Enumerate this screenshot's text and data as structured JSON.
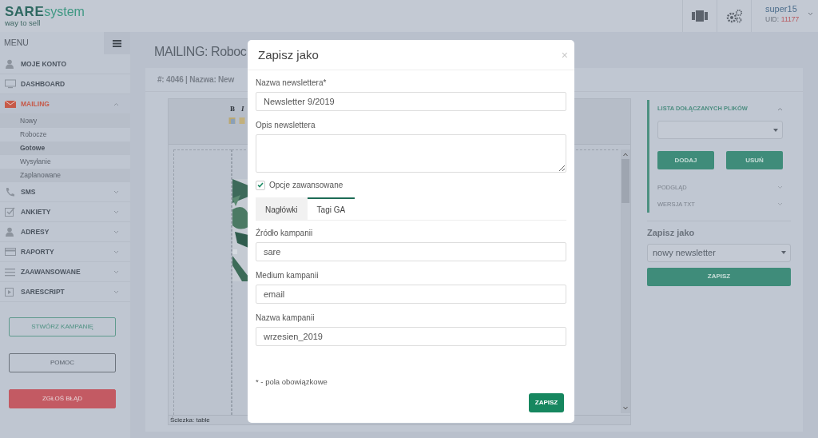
{
  "logo": {
    "brand": "SARE",
    "product": "system",
    "tagline": "way to sell"
  },
  "header": {
    "user": "super15",
    "uid_label": "UID:",
    "uid": "11177"
  },
  "sidebar": {
    "title": "MENU",
    "items": [
      {
        "label": "MOJE KONTO",
        "kind": "link",
        "selected": false
      },
      {
        "label": "DASHBOARD",
        "kind": "link",
        "selected": false
      },
      {
        "label": "MAILING",
        "kind": "group",
        "selected": true,
        "expanded": true,
        "children": [
          {
            "label": "Nowy",
            "selected": false
          },
          {
            "label": "Robocze",
            "selected": false
          },
          {
            "label": "Gotowe",
            "selected": true
          },
          {
            "label": "Wysyłanie",
            "selected": false
          },
          {
            "label": "Zaplanowane",
            "selected": false
          }
        ]
      },
      {
        "label": "SMS",
        "kind": "group",
        "selected": false,
        "expanded": false
      },
      {
        "label": "ANKIETY",
        "kind": "group",
        "selected": false,
        "expanded": false
      },
      {
        "label": "ADRESY",
        "kind": "group",
        "selected": false,
        "expanded": false
      },
      {
        "label": "RAPORTY",
        "kind": "group",
        "selected": false,
        "expanded": false
      },
      {
        "label": "ZAAWANSOWANE",
        "kind": "group",
        "selected": false,
        "expanded": false
      },
      {
        "label": "SARESCRIPT",
        "kind": "group",
        "selected": false,
        "expanded": false
      }
    ],
    "buttons": [
      {
        "label": "STWÓRZ KAMPANIĘ",
        "kind": "outline-primary"
      },
      {
        "label": "POMOC",
        "kind": "outline-dark"
      },
      {
        "label": "ZGŁOŚ BŁĄD",
        "kind": "danger"
      }
    ]
  },
  "main": {
    "title": "MAILING: Roboc",
    "panel_heading": "#: 4046 | Nazwa: New",
    "editor": {
      "toolbar": [
        "B",
        "I"
      ],
      "path": "Ściezka: table"
    },
    "attachments": {
      "title": "LISTA DOŁĄCZANYCH PLIKÓW",
      "expanded": true,
      "buttons": [
        "DODAJ",
        "USUŃ"
      ]
    },
    "sections": [
      {
        "title": "PODGLĄD",
        "expanded": false
      },
      {
        "title": "WERSJA TXT",
        "expanded": false
      }
    ],
    "save_as": {
      "title": "Zapisz jako",
      "value": "nowy newsletter",
      "button": "ZAPISZ"
    }
  },
  "modal": {
    "title": "Zapisz jako",
    "close": "×",
    "fields": [
      {
        "label": "Nazwa newslettera*",
        "kind": "input",
        "value": "Newsletter 9/2019"
      },
      {
        "label": "Opis newslettera",
        "kind": "textarea"
      }
    ],
    "advanced": {
      "label": "Opcje zawansowane",
      "checked": true
    },
    "tabs": [
      {
        "label": "Nagłówki",
        "selected": false
      },
      {
        "label": "Tagi GA",
        "selected": true
      }
    ],
    "tab_fields": [
      {
        "label": "Źródło kampanii",
        "value": "sare"
      },
      {
        "label": "Medium kampanii",
        "value": "email"
      },
      {
        "label": "Nazwa kampanii",
        "value": "wrzesien_2019"
      }
    ],
    "note": "* - pola obowiązkowe",
    "button": "ZAPISZ"
  }
}
